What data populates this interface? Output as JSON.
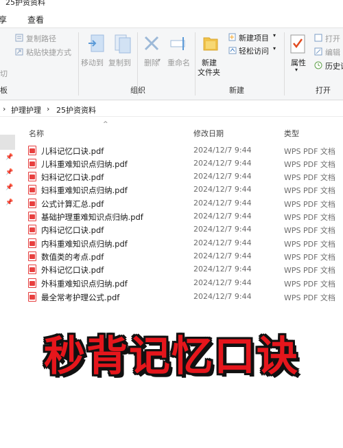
{
  "window": {
    "title": "25护资资料"
  },
  "menu": {
    "tabs": [
      "享",
      "查看"
    ]
  },
  "ribbon": {
    "clipboard_left": {
      "cut_label": "切",
      "group_label": "板"
    },
    "copy_path_label": "复制路径",
    "paste_shortcut_label": "粘贴快捷方式",
    "move_to_label": "移动到",
    "copy_to_label": "复制到",
    "delete_label": "删除",
    "rename_label": "重命名",
    "new_folder_label": "新建\n文件夹",
    "new_folder_line1": "新建",
    "new_folder_line2": "文件夹",
    "new_item_label": "新建项目",
    "easy_access_label": "轻松访问",
    "properties_label": "属性",
    "open_label": "打开",
    "edit_label": "编辑",
    "history_label": "历史记",
    "groups": {
      "organize": "组织",
      "new": "新建",
      "open": "打开"
    },
    "colors": {
      "accent": "#2b7cd3",
      "delete_x": "#d9342b",
      "folder": "#f0c24a"
    }
  },
  "address": {
    "crumbs": [
      "护理护理",
      "25护资资料"
    ]
  },
  "list": {
    "headers": {
      "name": "名称",
      "date": "修改日期",
      "type": "类型"
    },
    "files": [
      {
        "name": "儿科记忆口诀.pdf",
        "date": "2024/12/7 9:44",
        "type": "WPS PDF 文档"
      },
      {
        "name": "儿科重难知识点归纳.pdf",
        "date": "2024/12/7 9:44",
        "type": "WPS PDF 文档"
      },
      {
        "name": "妇科记忆口诀.pdf",
        "date": "2024/12/7 9:44",
        "type": "WPS PDF 文档"
      },
      {
        "name": "妇科重难知识点归纳.pdf",
        "date": "2024/12/7 9:44",
        "type": "WPS PDF 文档"
      },
      {
        "name": "公式计算汇总.pdf",
        "date": "2024/12/7 9:44",
        "type": "WPS PDF 文档"
      },
      {
        "name": "基础护理重难知识点归纳.pdf",
        "date": "2024/12/7 9:44",
        "type": "WPS PDF 文档"
      },
      {
        "name": "内科记忆口诀.pdf",
        "date": "2024/12/7 9:44",
        "type": "WPS PDF 文档"
      },
      {
        "name": "内科重难知识点归纳.pdf",
        "date": "2024/12/7 9:44",
        "type": "WPS PDF 文档"
      },
      {
        "name": "数值类的考点.pdf",
        "date": "2024/12/7 9:44",
        "type": "WPS PDF 文档"
      },
      {
        "name": "外科记忆口诀.pdf",
        "date": "2024/12/7 9:44",
        "type": "WPS PDF 文档"
      },
      {
        "name": "外科重难知识点归纳.pdf",
        "date": "2024/12/7 9:44",
        "type": "WPS PDF 文档"
      },
      {
        "name": "最全常考护理公式.pdf",
        "date": "2024/12/7 9:44",
        "type": "WPS PDF 文档"
      }
    ]
  },
  "overlay_title": "秒背记忆口诀",
  "icons": [
    "copy-path-icon",
    "paste-shortcut-icon",
    "move-to-icon",
    "copy-to-icon",
    "delete-icon",
    "rename-icon",
    "new-folder-icon",
    "new-item-icon",
    "easy-access-icon",
    "properties-icon",
    "open-icon",
    "edit-icon",
    "history-icon",
    "pin-icon",
    "pdf-file-icon",
    "sort-up-icon",
    "breadcrumb-chevron-icon"
  ]
}
